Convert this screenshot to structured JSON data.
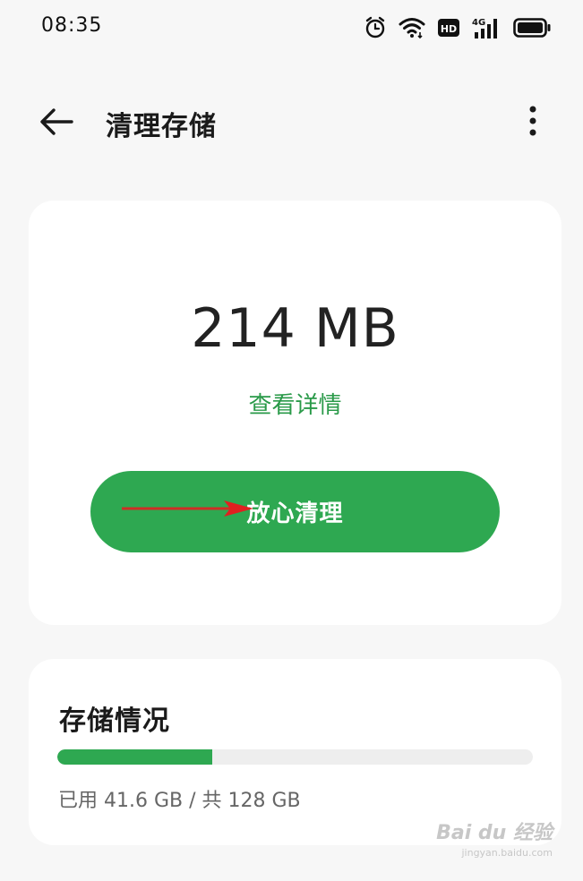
{
  "status_bar": {
    "time": "08:35",
    "icons": [
      "alarm-icon",
      "wifi-icon",
      "hd-icon",
      "signal-4g-icon",
      "battery-icon"
    ],
    "hd_label": "HD",
    "network_label": "4G"
  },
  "header": {
    "title": "清理存储",
    "back_icon": "arrow-left-icon",
    "more_icon": "more-vertical-icon"
  },
  "clean_card": {
    "size": "214 MB",
    "details_link": "查看详情",
    "clean_button": "放心清理"
  },
  "storage_card": {
    "title": "存储情况",
    "usage_text": "已用 41.6 GB / 共 128 GB",
    "used_fraction": 0.325
  },
  "colors": {
    "accent": "#2ea851",
    "link": "#2a9a49",
    "background": "#f7f7f7",
    "card": "#ffffff",
    "annotation": "#e02020"
  },
  "watermark": {
    "logo": "Bai du 经验",
    "url": "jingyan.baidu.com"
  }
}
